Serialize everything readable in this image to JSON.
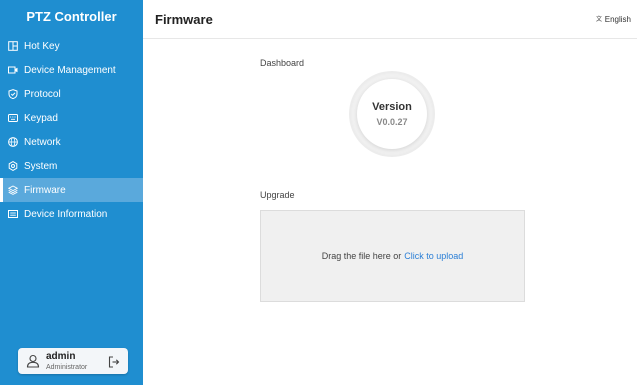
{
  "app": {
    "title": "PTZ Controller"
  },
  "sidebar": {
    "items": [
      {
        "label": "Hot Key",
        "icon": "hotkey-icon",
        "active": false
      },
      {
        "label": "Device Management",
        "icon": "camera-icon",
        "active": false
      },
      {
        "label": "Protocol",
        "icon": "shield-icon",
        "active": false
      },
      {
        "label": "Keypad",
        "icon": "keyboard-icon",
        "active": false
      },
      {
        "label": "Network",
        "icon": "globe-icon",
        "active": false
      },
      {
        "label": "System",
        "icon": "gear-icon",
        "active": false
      },
      {
        "label": "Firmware",
        "icon": "layers-icon",
        "active": true
      },
      {
        "label": "Device Information",
        "icon": "info-card-icon",
        "active": false
      }
    ]
  },
  "user": {
    "name": "admin",
    "role": "Administrator"
  },
  "header": {
    "title": "Firmware",
    "language": "English"
  },
  "dashboard": {
    "label": "Dashboard",
    "version_title": "Version",
    "version_value": "V0.0.27"
  },
  "upgrade": {
    "label": "Upgrade",
    "drag_text": "Drag the file here or",
    "upload_link": "Click to upload"
  },
  "colors": {
    "sidebar": "#1f8ed0",
    "active_item": "#5aa9dc",
    "link": "#2b7fd6"
  }
}
